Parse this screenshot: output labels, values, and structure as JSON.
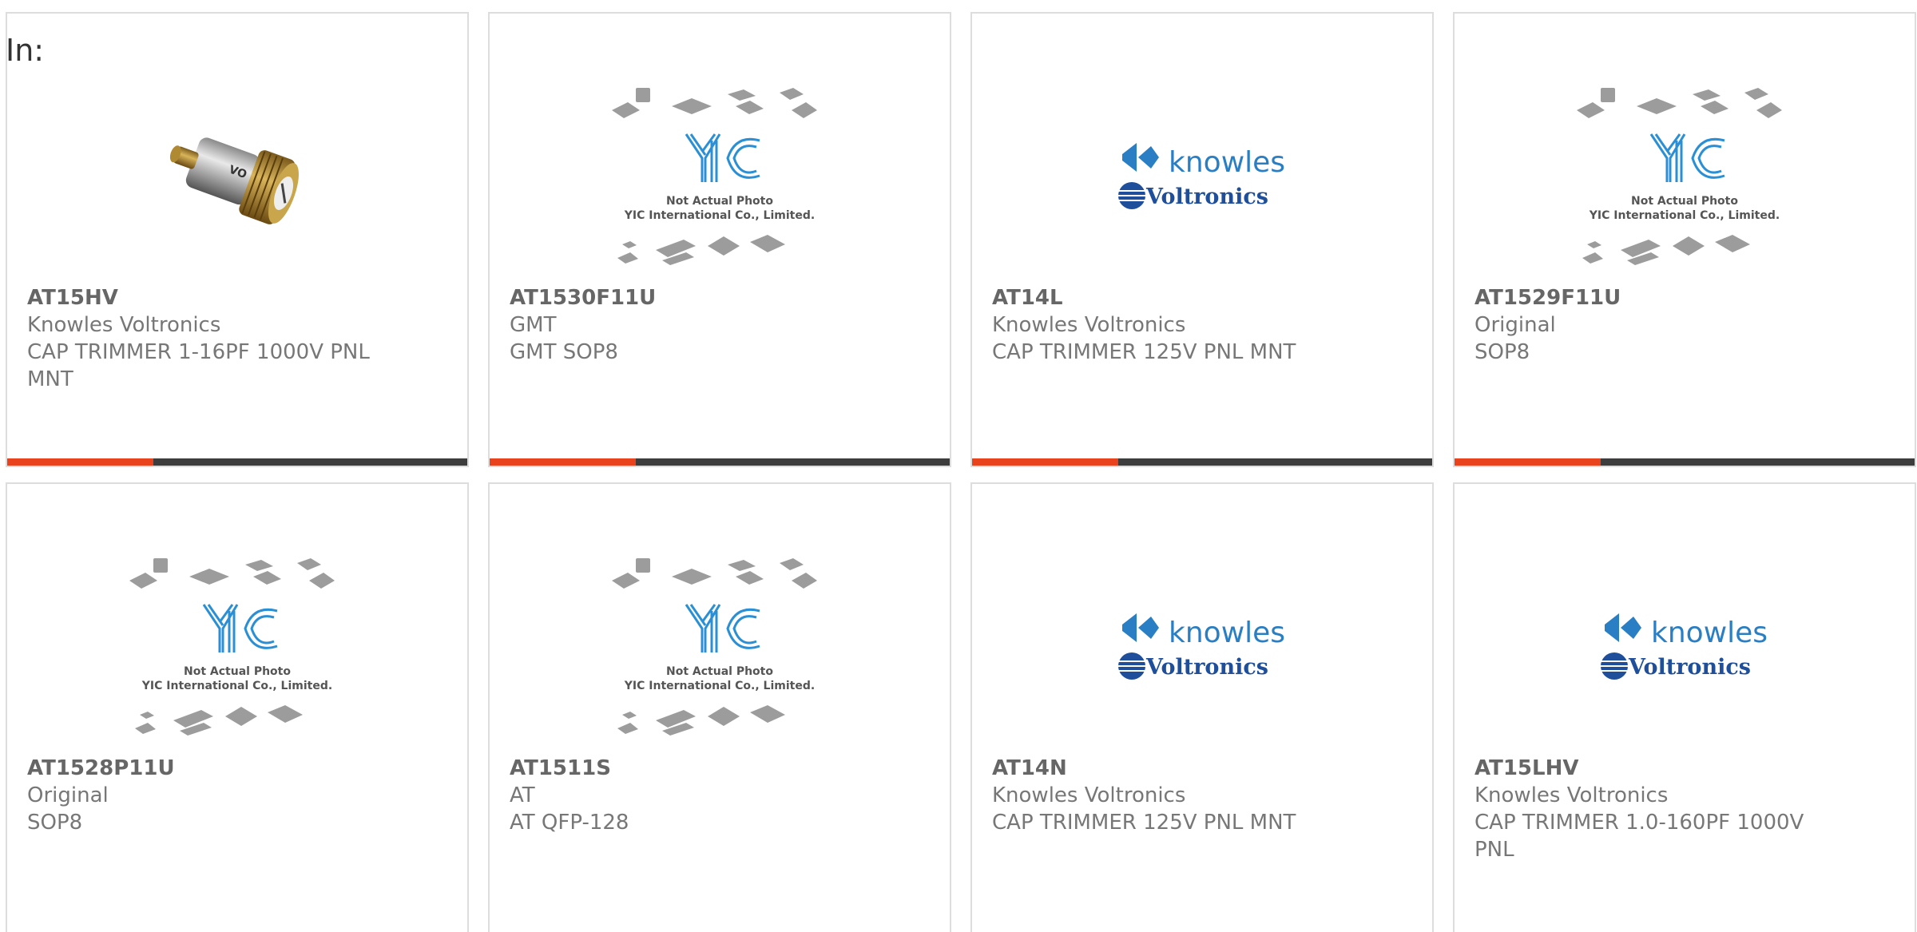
{
  "header": {
    "in_label": "In:"
  },
  "colors": {
    "accent": "#e8431d",
    "bar": "#3d3d3d",
    "border": "#dddddd",
    "knowles_blue": "#2a7fc4",
    "voltronics_navy": "#1f4f9a"
  },
  "products": [
    {
      "part": "AT15HV",
      "manufacturer": "Knowles Voltronics",
      "description": "CAP TRIMMER 1-16PF 1000V PNL MNT",
      "image": "trimmer-capacitor-photo"
    },
    {
      "part": "AT1530F11U",
      "manufacturer": "GMT",
      "description": "GMT SOP8",
      "image": "yic-placeholder",
      "image_text": [
        "Not Actual Photo",
        "YIC International Co., Limited."
      ]
    },
    {
      "part": "AT14L",
      "manufacturer": "Knowles Voltronics",
      "description": "CAP TRIMMER 125V PNL MNT",
      "image": "knowles-voltronics-logo",
      "logo_text": [
        "knowles",
        "Voltronics"
      ]
    },
    {
      "part": "AT1529F11U",
      "manufacturer": "Original",
      "description": "SOP8",
      "image": "yic-placeholder",
      "image_text": [
        "Not Actual Photo",
        "YIC International Co., Limited."
      ]
    },
    {
      "part": "AT1528P11U",
      "manufacturer": "Original",
      "description": "SOP8",
      "image": "yic-placeholder",
      "image_text": [
        "Not Actual Photo",
        "YIC International Co., Limited."
      ]
    },
    {
      "part": "AT1511S",
      "manufacturer": "AT",
      "description": "AT QFP-128",
      "image": "yic-placeholder",
      "image_text": [
        "Not Actual Photo",
        "YIC International Co., Limited."
      ]
    },
    {
      "part": "AT14N",
      "manufacturer": "Knowles Voltronics",
      "description": "CAP TRIMMER 125V PNL MNT",
      "image": "knowles-voltronics-logo",
      "logo_text": [
        "knowles",
        "Voltronics"
      ]
    },
    {
      "part": "AT15LHV",
      "manufacturer": "Knowles Voltronics",
      "description": "CAP TRIMMER 1.0-160PF 1000V PNL",
      "image": "knowles-voltronics-logo",
      "logo_text": [
        "knowles",
        "Voltronics"
      ]
    }
  ]
}
